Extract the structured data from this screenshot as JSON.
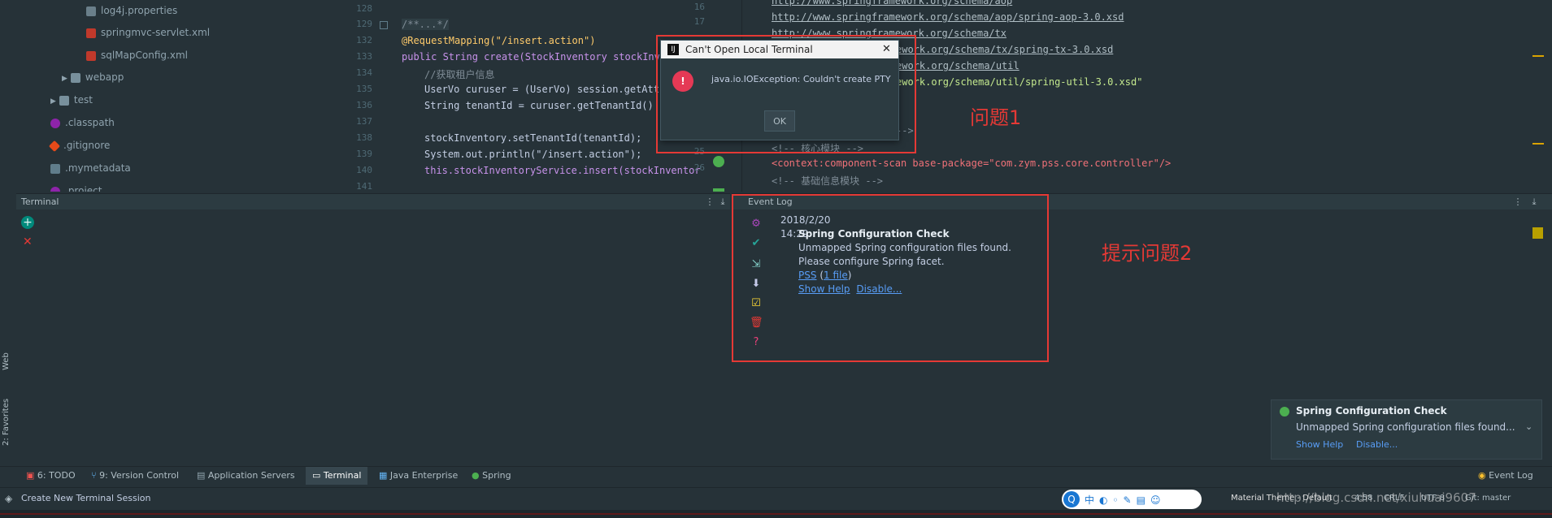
{
  "tree": {
    "items": [
      {
        "label": "log4j.properties"
      },
      {
        "label": "springmvc-servlet.xml"
      },
      {
        "label": "sqlMapConfig.xml"
      },
      {
        "label": "webapp"
      },
      {
        "label": "test"
      },
      {
        "label": ".classpath"
      },
      {
        "label": ".gitignore"
      },
      {
        "label": ".mymetadata"
      },
      {
        "label": ".project"
      }
    ]
  },
  "editor": {
    "line_numbers": [
      "128",
      "129",
      "132",
      "133",
      "134",
      "135",
      "136",
      "137",
      "138",
      "139",
      "140",
      "141"
    ],
    "lines": [
      "",
      "/**...*/",
      "@RequestMapping(\"/insert.action\")",
      "public String create(StockInventory stockInvent",
      "//获取租户信息",
      "UserVo curuser = (UserVo) session.getAttri",
      "String tenantId = curuser.getTenantId() ;",
      "",
      "stockInventory.setTenantId(tenantId);",
      "System.out.println(\"/insert.action\");",
      "this.stockInventoryService.insert(stockInventor",
      ""
    ]
  },
  "xml_gutter": [
    "16",
    "17",
    "18",
    "19",
    "20",
    "21",
    "22",
    "23",
    "24",
    "25",
    "26"
  ],
  "xml": {
    "lines": [
      "http://www.springframework.org/schema/aop",
      "http://www.springframework.org/schema/aop/spring-aop-3.0.xsd",
      "http://www.springframework.org/schema/tx",
      "ework.org/schema/tx/spring-tx-3.0.xsd",
      "ework.org/schema/util",
      "ework.org/schema/util/spring-util-3.0.xsd\"",
      "-->",
      "<!-- 核心模块 -->",
      "<context:component-scan base-package=\"com.zym.pss.core.controller\"/>",
      "<!-- 基础信息模块 -->"
    ]
  },
  "dialog": {
    "title": "Can't Open Local Terminal",
    "message": "java.io.IOException: Couldn't create PTY",
    "ok_label": "OK",
    "close_glyph": "✕"
  },
  "terminal": {
    "title": "Terminal"
  },
  "event_log": {
    "title": "Event Log",
    "date": "2018/2/20",
    "time": "14:29",
    "heading": "Spring Configuration Check",
    "line1": "Unmapped Spring configuration files found.",
    "line2": "Please configure Spring facet.",
    "link_pss": "PSS",
    "link_file": "1 file",
    "link_help": "Show Help",
    "link_disable": "Disable..."
  },
  "annotations": {
    "problem1": "问题1",
    "problem2": "提示问题2"
  },
  "notification": {
    "title": "Spring Configuration Check",
    "body": "Unmapped Spring configuration files found...",
    "show_help": "Show Help",
    "disable": "Disable..."
  },
  "side_tabs": {
    "web": "Web",
    "favorites": "2: Favorites"
  },
  "toolbar": {
    "todo": "6: TODO",
    "vcs": "9: Version Control",
    "app_servers": "Application Servers",
    "terminal": "Terminal",
    "java_ee": "Java Enterprise",
    "spring": "Spring",
    "event_log": "Event Log"
  },
  "status": {
    "message": "Create New Terminal Session",
    "theme": "Material Theme - Default",
    "position": "4:58",
    "line_sep": "CRLF",
    "encoding": "UTF-8",
    "git": "Git: master",
    "watermark": "http://blog.csdn.net/xiuhuai9607"
  },
  "colors": {
    "red_box": "#e53935",
    "accent_green": "#4caf50",
    "link_blue": "#589df6"
  }
}
